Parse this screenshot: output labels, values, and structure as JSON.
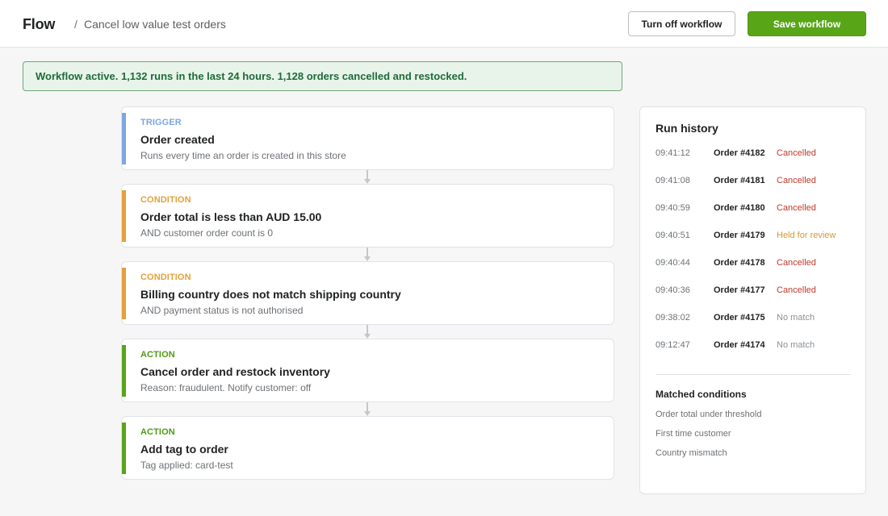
{
  "app": {
    "name": "Flow"
  },
  "breadcrumb": {
    "separator": "/",
    "current": "Cancel low value test orders"
  },
  "header_actions": {
    "turn_off_label": "Turn off workflow",
    "save_label": "Save workflow"
  },
  "banner": {
    "text": "Workflow active. 1,132 runs in the last 24 hours. 1,128 orders cancelled and restocked."
  },
  "steps": [
    {
      "kind": "Trigger",
      "title": "Order created",
      "detail": "Runs every time an order is created in this store"
    },
    {
      "kind": "Condition",
      "title": "Order total is less than AUD 15.00",
      "detail": "AND customer order count is 0"
    },
    {
      "kind": "Condition",
      "title": "Billing country does not match shipping country",
      "detail": "AND payment status is not authorised"
    },
    {
      "kind": "Action",
      "title": "Cancel order and restock inventory",
      "detail": "Reason: fraudulent. Notify customer: off"
    },
    {
      "kind": "Action",
      "title": "Add tag to order",
      "detail": "Tag applied: card-test"
    }
  ],
  "run_history": {
    "title": "Run history",
    "runs": [
      {
        "time": "09:41:12",
        "order": "Order #4182",
        "status": "Cancelled"
      },
      {
        "time": "09:41:08",
        "order": "Order #4181",
        "status": "Cancelled"
      },
      {
        "time": "09:40:59",
        "order": "Order #4180",
        "status": "Cancelled"
      },
      {
        "time": "09:40:51",
        "order": "Order #4179",
        "status": "Held for review"
      },
      {
        "time": "09:40:44",
        "order": "Order #4178",
        "status": "Cancelled"
      },
      {
        "time": "09:40:36",
        "order": "Order #4177",
        "status": "Cancelled"
      },
      {
        "time": "09:38:02",
        "order": "Order #4175",
        "status": "No match"
      },
      {
        "time": "09:12:47",
        "order": "Order #4174",
        "status": "No match"
      }
    ],
    "matched_title": "Matched conditions",
    "matched": [
      "Order total under threshold",
      "First time customer",
      "Country mismatch"
    ]
  },
  "colors": {
    "trigger": "#7fa6e0",
    "condition": "#e3a13b",
    "action": "#58a618",
    "primary_button": "#58a618",
    "banner_bg": "#e8f4ea",
    "banner_text": "#1f6b3a",
    "status_cancelled": "#c03a2b",
    "status_held": "#d39a2f",
    "status_no_match": "#8c9196"
  }
}
